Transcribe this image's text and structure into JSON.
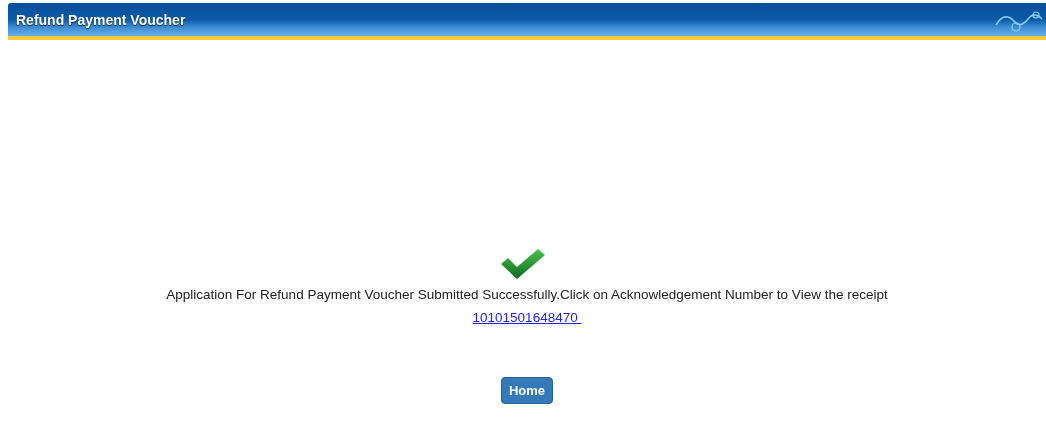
{
  "window": {
    "title": "Refund Payment Voucher"
  },
  "message": "Application For Refund Payment Voucher Submitted Successfully.Click on Acknowledgement Number to View the receipt",
  "acknowledgement_link": "10101501648470 ",
  "buttons": [
    "Home"
  ]
}
